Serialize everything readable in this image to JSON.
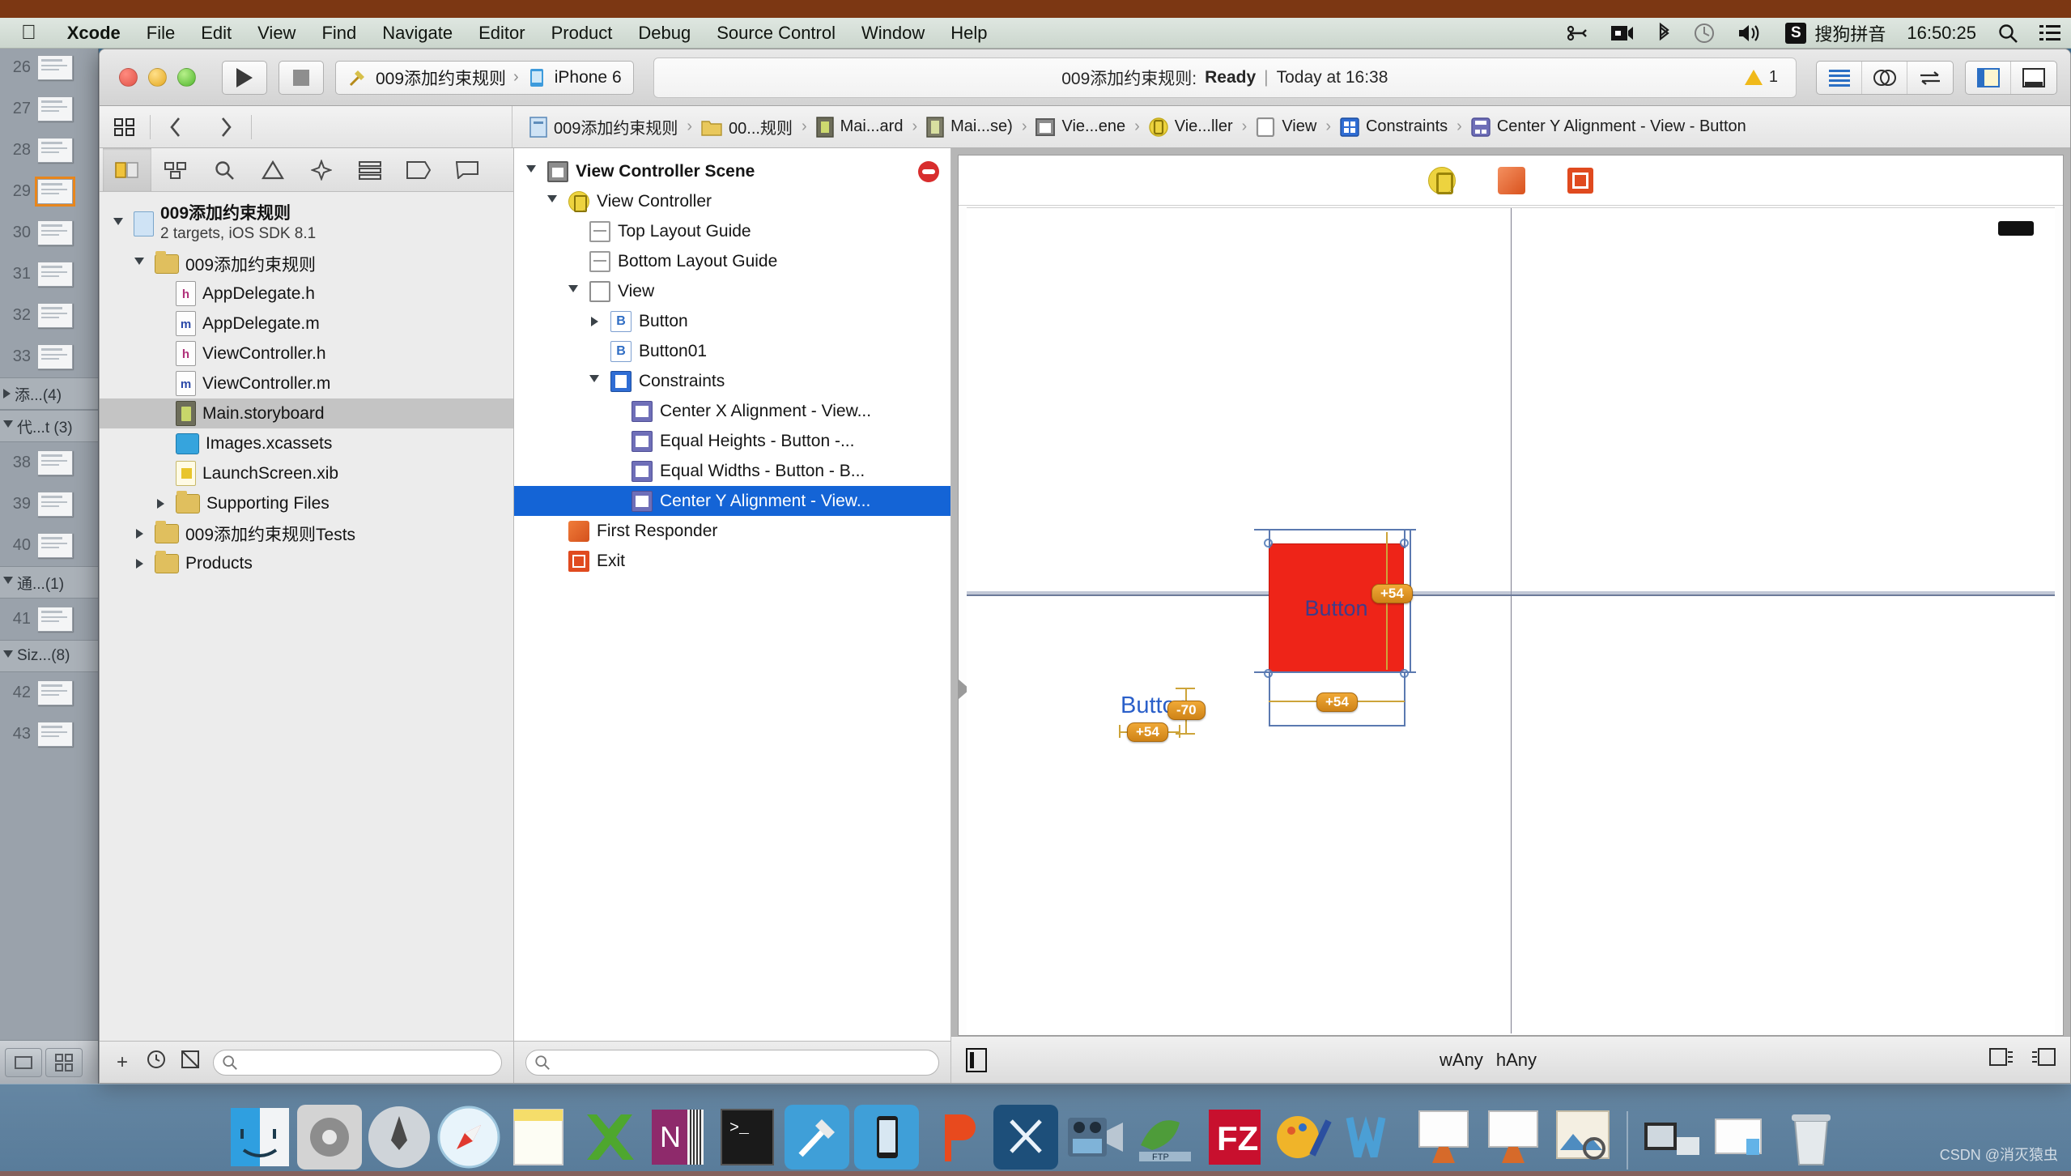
{
  "menubar": {
    "apple_icon": "apple-logo-icon",
    "items": [
      "Xcode",
      "File",
      "Edit",
      "View",
      "Find",
      "Navigate",
      "Editor",
      "Product",
      "Debug",
      "Source Control",
      "Window",
      "Help"
    ],
    "app_name": "Xcode",
    "status_icons": [
      "scissors-icon",
      "screen-record-icon",
      "bluetooth-icon",
      "time-machine-icon",
      "volume-icon"
    ],
    "input_method_badge": "S",
    "input_method_label": "搜狗拼音",
    "clock": "16:50:25",
    "spotlight_icon": "search-icon",
    "notification_icon": "notification-center-icon"
  },
  "toolbar": {
    "run_icon": "play-icon",
    "stop_icon": "stop-icon",
    "scheme_name": "009添加约束规则",
    "scheme_separator": "›",
    "destination": "iPhone 6",
    "status_project": "009添加约束规则:",
    "status_state": "Ready",
    "status_divider": "|",
    "status_time": "Today at 16:38",
    "warning_count": "1",
    "editor_buttons": [
      "standard-editor-icon",
      "assistant-editor-icon",
      "version-editor-icon"
    ],
    "view_buttons": [
      "navigator-toggle-icon",
      "utilities-toggle-icon"
    ]
  },
  "jumpbar": {
    "related_icon": "related-files-icon",
    "back_icon": "chevron-left-icon",
    "forward_icon": "chevron-right-icon",
    "crumbs": [
      {
        "label": "009添加约束规则",
        "icon": "project-icon"
      },
      {
        "label": "00...规则",
        "icon": "folder-icon"
      },
      {
        "label": "Mai...ard",
        "icon": "storyboard-icon"
      },
      {
        "label": "Mai...se)",
        "icon": "storyboard-scene-icon"
      },
      {
        "label": "Vie...ene",
        "icon": "scene-icon"
      },
      {
        "label": "Vie...ller",
        "icon": "view-controller-icon"
      },
      {
        "label": "View",
        "icon": "view-icon"
      },
      {
        "label": "Constraints",
        "icon": "constraints-icon"
      },
      {
        "label": "Center Y Alignment - View - Button",
        "icon": "constraint-icon"
      }
    ],
    "separator": "›"
  },
  "document_title": "Main.storyboard",
  "navigator": {
    "tabs": [
      "project-navigator-icon",
      "symbol-navigator-icon",
      "find-navigator-icon",
      "issue-navigator-icon",
      "test-navigator-icon",
      "debug-navigator-icon",
      "breakpoint-navigator-icon",
      "report-navigator-icon"
    ],
    "active_tab_index": 0,
    "tree": [
      {
        "label": "009添加约束规则",
        "sub": "2 targets, iOS SDK 8.1",
        "icon": "project-icon",
        "depth": 0,
        "twisty": "down",
        "bold": true
      },
      {
        "label": "009添加约束规则",
        "icon": "folder-icon",
        "depth": 1,
        "twisty": "down"
      },
      {
        "label": "AppDelegate.h",
        "icon": "header-file-icon",
        "depth": 2,
        "badge": "h"
      },
      {
        "label": "AppDelegate.m",
        "icon": "objc-file-icon",
        "depth": 2,
        "badge": "m"
      },
      {
        "label": "ViewController.h",
        "icon": "header-file-icon",
        "depth": 2,
        "badge": "h"
      },
      {
        "label": "ViewController.m",
        "icon": "objc-file-icon",
        "depth": 2,
        "badge": "m"
      },
      {
        "label": "Main.storyboard",
        "icon": "storyboard-file-icon",
        "depth": 2,
        "selected": true
      },
      {
        "label": "Images.xcassets",
        "icon": "xcassets-icon",
        "depth": 2
      },
      {
        "label": "LaunchScreen.xib",
        "icon": "xib-file-icon",
        "depth": 2
      },
      {
        "label": "Supporting Files",
        "icon": "folder-icon",
        "depth": 2,
        "twisty": "right"
      },
      {
        "label": "009添加约束规则Tests",
        "icon": "folder-icon",
        "depth": 1,
        "twisty": "right"
      },
      {
        "label": "Products",
        "icon": "folder-icon",
        "depth": 1,
        "twisty": "right"
      }
    ],
    "bottom": {
      "add_icon": "plus-icon",
      "recent_icon": "clock-icon",
      "source_control_icon": "source-control-filter-icon",
      "filter_placeholder": "",
      "filter_value": "",
      "filter_search_icon": "search-icon"
    }
  },
  "outline": {
    "tree": [
      {
        "label": "View Controller Scene",
        "icon": "scene-icon",
        "depth": 0,
        "twisty": "down",
        "bold": true,
        "trailing": "scene-stop-badge"
      },
      {
        "label": "View Controller",
        "icon": "view-controller-icon",
        "depth": 1,
        "twisty": "down"
      },
      {
        "label": "Top Layout Guide",
        "icon": "top-layout-guide-icon",
        "depth": 2
      },
      {
        "label": "Bottom Layout Guide",
        "icon": "bottom-layout-guide-icon",
        "depth": 2
      },
      {
        "label": "View",
        "icon": "view-icon",
        "depth": 2,
        "twisty": "down"
      },
      {
        "label": "Button",
        "icon": "button-icon",
        "depth": 3,
        "twisty": "right"
      },
      {
        "label": "Button01",
        "icon": "button-icon",
        "depth": 3
      },
      {
        "label": "Constraints",
        "icon": "constraints-icon",
        "depth": 3,
        "twisty": "down"
      },
      {
        "label": "Center X Alignment - View...",
        "icon": "constraint-icon",
        "depth": 4
      },
      {
        "label": "Equal Heights - Button -...",
        "icon": "constraint-icon",
        "depth": 4
      },
      {
        "label": "Equal Widths - Button - B...",
        "icon": "constraint-icon",
        "depth": 4
      },
      {
        "label": "Center Y Alignment - View...",
        "icon": "constraint-icon",
        "depth": 4,
        "selected": true
      },
      {
        "label": "First Responder",
        "icon": "first-responder-icon",
        "depth": 1
      },
      {
        "label": "Exit",
        "icon": "exit-icon",
        "depth": 1
      }
    ],
    "bottom": {
      "filter_placeholder": "",
      "filter_value": ""
    }
  },
  "canvas": {
    "scene_dock_icons": [
      "view-controller-dock-icon",
      "first-responder-dock-icon",
      "exit-dock-icon"
    ],
    "selected_button_label": "Button",
    "second_button_label": "Button",
    "constraint_badges": [
      {
        "value": "+54",
        "name": "width-constraint-badge"
      },
      {
        "value": "+54",
        "name": "height-constraint-badge"
      },
      {
        "value": "-70",
        "name": "vertical-offset-badge"
      },
      {
        "value": "+54",
        "name": "second-width-badge"
      }
    ],
    "bottom_bar": {
      "view_as_icon": "view-as-icon",
      "size_class_w": "wAny",
      "size_class_h": "hAny",
      "zoom_out_icon": "zoom-out-icon",
      "zoom_in_icon": "zoom-in-icon"
    }
  },
  "behind_window": {
    "rows": [
      {
        "type": "slide",
        "num": "26"
      },
      {
        "type": "slide",
        "num": "27"
      },
      {
        "type": "slide",
        "num": "28"
      },
      {
        "type": "slide",
        "num": "29",
        "selected": true
      },
      {
        "type": "slide",
        "num": "30"
      },
      {
        "type": "slide",
        "num": "31"
      },
      {
        "type": "slide",
        "num": "32"
      },
      {
        "type": "slide",
        "num": "33"
      },
      {
        "type": "group",
        "label": "添...(4)",
        "twisty": "right"
      },
      {
        "type": "group",
        "label": "代...t (3)",
        "twisty": "down"
      },
      {
        "type": "slide",
        "num": "38"
      },
      {
        "type": "slide",
        "num": "39"
      },
      {
        "type": "slide",
        "num": "40"
      },
      {
        "type": "group",
        "label": "通...(1)",
        "twisty": "down"
      },
      {
        "type": "slide",
        "num": "41"
      },
      {
        "type": "group",
        "label": "Siz...(8)",
        "twisty": "down"
      },
      {
        "type": "slide",
        "num": "42"
      },
      {
        "type": "slide",
        "num": "43"
      }
    ]
  },
  "dock": {
    "apps": [
      {
        "name": "finder-dock-icon",
        "running": true
      },
      {
        "name": "system-preferences-dock-icon",
        "running": false
      },
      {
        "name": "launchpad-dock-icon",
        "running": false
      },
      {
        "name": "safari-dock-icon",
        "running": false
      },
      {
        "name": "notes-dock-icon",
        "running": false
      },
      {
        "name": "excel-dock-icon",
        "running": false
      },
      {
        "name": "onenote-dock-icon",
        "running": false
      },
      {
        "name": "terminal-dock-icon",
        "running": false
      },
      {
        "name": "xcode-dock-icon",
        "running": true
      },
      {
        "name": "simulator-dock-icon",
        "running": true
      },
      {
        "name": "prezi-dock-icon",
        "running": true
      },
      {
        "name": "snipping-dock-icon",
        "running": false
      },
      {
        "name": "quicktime-dock-icon",
        "running": true
      },
      {
        "name": "filezilla-ftp-dock-icon",
        "running": false
      },
      {
        "name": "filezilla-dock-icon",
        "running": false
      },
      {
        "name": "paint-dock-icon",
        "running": false
      },
      {
        "name": "word-dock-icon",
        "running": false
      },
      {
        "name": "keynote-dock-icon",
        "running": true
      },
      {
        "name": "keynote2-dock-icon",
        "running": true
      },
      {
        "name": "preview-dock-icon",
        "running": true
      }
    ],
    "stacks": [
      {
        "name": "downloads-stack-icon"
      },
      {
        "name": "documents-stack-icon"
      },
      {
        "name": "trash-dock-icon"
      }
    ]
  },
  "watermark": "CSDN @消灭猿虫"
}
